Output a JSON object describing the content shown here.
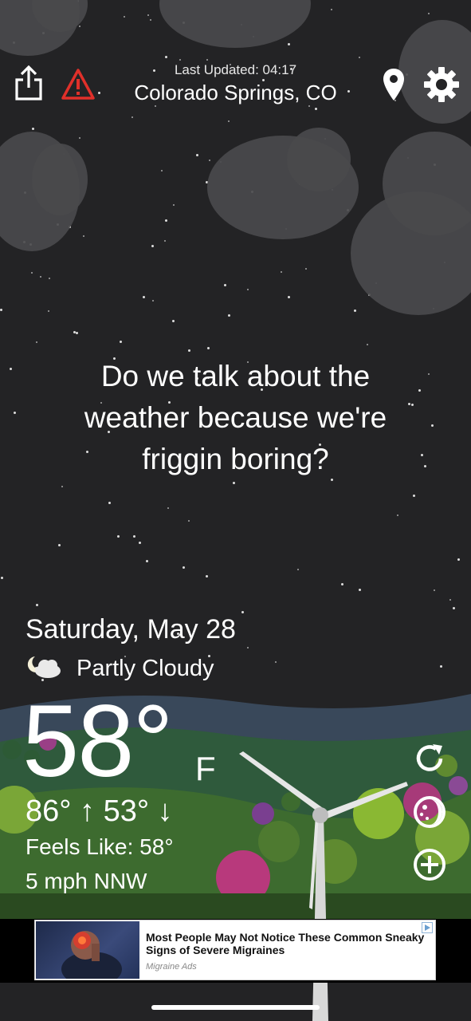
{
  "header": {
    "last_updated": "Last Updated: 04:17",
    "location": "Colorado Springs, CO"
  },
  "icons": {
    "share": "share-icon",
    "alert": "alert-triangle-icon",
    "location": "map-pin-icon",
    "settings": "gear-icon",
    "condition": "partly-cloudy-night-icon",
    "refresh": "refresh-icon",
    "moon": "moon-phase-icon",
    "add": "plus-circle-icon"
  },
  "quote": {
    "line1": "Do we talk about the",
    "line2": "weather because we're",
    "line3": "friggin boring?"
  },
  "weather": {
    "date": "Saturday, May 28",
    "condition": "Partly Cloudy",
    "temperature": "58°",
    "unit": "F",
    "high_low": "86° ↑  53° ↓",
    "feels_like": "Feels Like: 58°",
    "wind": "5 mph NNW"
  },
  "ad": {
    "title": "Most People May Not Notice These Common Sneaky Signs of Severe Migraines",
    "source": "Migraine Ads"
  },
  "colors": {
    "sky": "#232325",
    "cloud": "#4a4a4c",
    "alert_red": "#e0302a",
    "hill": "#3a4a58",
    "grass": "#3f6a2e"
  }
}
